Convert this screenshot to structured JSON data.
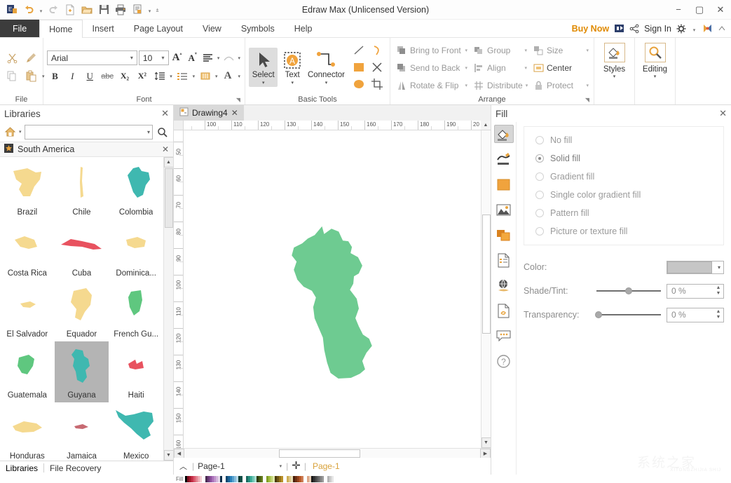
{
  "window": {
    "title": "Edraw Max (Unlicensed Version)",
    "minimize": "−",
    "maximize": "▢",
    "close": "✕"
  },
  "quick_access": {
    "logo": "edraw-logo-icon",
    "undo": "undo-icon",
    "undo_caret": "▾",
    "redo": "redo-icon",
    "new": "new-document-icon",
    "open": "open-folder-icon",
    "save": "save-icon",
    "print": "print-icon",
    "more": "quick-access-more-icon",
    "more_caret": "▾",
    "customize_caret": "▾"
  },
  "menu": {
    "file": "File",
    "tabs": [
      {
        "label": "Home",
        "active": true
      },
      {
        "label": "Insert",
        "active": false
      },
      {
        "label": "Page Layout",
        "active": false
      },
      {
        "label": "View",
        "active": false
      },
      {
        "label": "Symbols",
        "active": false
      },
      {
        "label": "Help",
        "active": false
      }
    ],
    "buy_now": "Buy Now",
    "sign_in": "Sign In",
    "cloud_icon": "cloud-save-icon",
    "share_icon": "share-icon",
    "settings_icon": "gear-icon",
    "settings_caret": "▾",
    "account_icon": "account-icon",
    "collapse_icon": "collapse-ribbon-icon"
  },
  "ribbon": {
    "file_group": {
      "title": "File",
      "cut": "cut-icon",
      "format_painter": "format-painter-icon",
      "copy": "copy-icon",
      "paste": "paste-icon",
      "paste_caret": "▾"
    },
    "font_group": {
      "title": "Font",
      "font_family": "Arial",
      "font_size": "10",
      "family_caret": "▾",
      "size_caret": "▾",
      "grow_font": "A",
      "shrink_font": "A",
      "align_icon": "text-align-icon",
      "align_caret": "▾",
      "curve_icon": "text-curve-icon",
      "curve_caret": "▾",
      "bold": "B",
      "italic": "I",
      "underline": "U",
      "strikethrough": "abc",
      "subscript": "X₂",
      "superscript": "X²",
      "line_spacing": "line-spacing-icon",
      "line_spacing_caret": "▾",
      "bullets": "bullet-list-icon",
      "bullets_caret": "▾",
      "highlight": "text-highlight-icon",
      "highlight_caret": "▾",
      "font_color": "A",
      "font_color_caret": "▾",
      "launcher": "◥"
    },
    "basic_tools": {
      "title": "Basic Tools",
      "select": {
        "label": "Select",
        "icon": "cursor-arrow-icon",
        "caret": "▾"
      },
      "text": {
        "label": "Text",
        "icon": "text-box-icon",
        "caret": "▾"
      },
      "connector": {
        "label": "Connector",
        "icon": "connector-icon",
        "caret": "▾"
      },
      "shapes": [
        {
          "name": "line-tool-icon"
        },
        {
          "name": "arc-tool-icon"
        },
        {
          "name": "rectangle-tool-icon"
        },
        {
          "name": "pen-tool-icon"
        },
        {
          "name": "ellipse-tool-icon"
        },
        {
          "name": "crop-tool-icon"
        }
      ]
    },
    "arrange": {
      "title": "Arrange",
      "items": [
        {
          "label": "Bring to Front",
          "icon": "bring-to-front-icon",
          "caret": "▾"
        },
        {
          "label": "Group",
          "icon": "group-icon",
          "caret": "▾"
        },
        {
          "label": "Size",
          "icon": "size-icon",
          "caret": "▾"
        },
        {
          "label": "Send to Back",
          "icon": "send-to-back-icon",
          "caret": "▾"
        },
        {
          "label": "Align",
          "icon": "align-icon",
          "caret": "▾"
        },
        {
          "label": "Center",
          "icon": "center-icon",
          "caret": ""
        },
        {
          "label": "Rotate & Flip",
          "icon": "rotate-flip-icon",
          "caret": "▾"
        },
        {
          "label": "Distribute",
          "icon": "distribute-icon",
          "caret": "▾"
        },
        {
          "label": "Protect",
          "icon": "protect-lock-icon",
          "caret": "▾"
        }
      ],
      "launcher": "◥"
    },
    "styles": {
      "label": "Styles",
      "icon": "styles-paint-icon",
      "caret": "▾"
    },
    "editing": {
      "label": "Editing",
      "icon": "magnifier-icon",
      "caret": "▾"
    }
  },
  "libraries": {
    "title": "Libraries",
    "close": "✕",
    "home_icon": "home-icon",
    "home_caret": "▾",
    "search_placeholder": "",
    "search_value": "",
    "search_caret": "▾",
    "search_icon": "search-icon",
    "category": {
      "icon": "library-category-icon",
      "name": "South America",
      "close": "✕"
    },
    "shapes": [
      {
        "name": "Brazil",
        "color": "#f5d98f",
        "selected": false
      },
      {
        "name": "Chile",
        "color": "#f5d98f",
        "selected": false
      },
      {
        "name": "Colombia",
        "color": "#3fb8b0",
        "selected": false
      },
      {
        "name": "Costa Rica",
        "color": "#f5d98f",
        "selected": false
      },
      {
        "name": "Cuba",
        "color": "#e8525f",
        "selected": false
      },
      {
        "name": "Dominica...",
        "color": "#f5d98f",
        "selected": false
      },
      {
        "name": "El Salvador",
        "color": "#f5d98f",
        "selected": false
      },
      {
        "name": "Equador",
        "color": "#f5d98f",
        "selected": false
      },
      {
        "name": "French Gu...",
        "color": "#5fc77f",
        "selected": false
      },
      {
        "name": "Guatemala",
        "color": "#5fc77f",
        "selected": false
      },
      {
        "name": "Guyana",
        "color": "#3fb8b0",
        "selected": true
      },
      {
        "name": "Haiti",
        "color": "#e8525f",
        "selected": false
      },
      {
        "name": "Honduras",
        "color": "#f5d98f",
        "selected": false
      },
      {
        "name": "Jamaica",
        "color": "#c76a72",
        "selected": false
      },
      {
        "name": "Mexico",
        "color": "#3fb8b0",
        "selected": false
      }
    ],
    "scroll_up": "▲",
    "scroll_down": "▼",
    "bottom_tabs": [
      {
        "label": "Libraries",
        "active": true
      },
      {
        "label": "File Recovery",
        "active": false
      }
    ]
  },
  "canvas": {
    "document_tab": {
      "icon": "document-icon",
      "name": "Drawing4",
      "close": "✕"
    },
    "h_ruler_labels": [
      "100",
      "110",
      "120",
      "130",
      "140",
      "150",
      "160",
      "170",
      "180",
      "190",
      "20"
    ],
    "v_ruler_labels": [
      "50",
      "60",
      "70",
      "80",
      "90",
      "100",
      "110",
      "120",
      "130",
      "140",
      "150",
      "160"
    ],
    "shape": {
      "name": "guyana-map-shape",
      "fill": "#6ecb91"
    },
    "scroll_left": "◀",
    "scroll_right": "▶",
    "scroll_up": "▲",
    "scroll_down": "▼"
  },
  "status": {
    "collapse": "︿",
    "page_name": "Page-1",
    "page_caret": "▾",
    "add_page": "✛",
    "page_tab": "Page-1",
    "fill_label": "Fill"
  },
  "fill_panel": {
    "title": "Fill",
    "close": "✕",
    "side_icons": [
      {
        "name": "fill-bucket-icon",
        "selected": true
      },
      {
        "name": "line-style-icon",
        "selected": false
      },
      {
        "name": "shape-color-icon",
        "selected": false
      },
      {
        "name": "picture-icon",
        "selected": false
      },
      {
        "name": "shadow-icon",
        "selected": false
      },
      {
        "name": "page-setup-icon",
        "selected": false
      },
      {
        "name": "theme-globe-icon",
        "selected": false
      },
      {
        "name": "hyperlink-icon",
        "selected": false
      },
      {
        "name": "comment-icon",
        "selected": false
      },
      {
        "name": "help-icon",
        "selected": false
      }
    ],
    "options": [
      {
        "label": "No fill",
        "selected": false
      },
      {
        "label": "Solid fill",
        "selected": true
      },
      {
        "label": "Gradient fill",
        "selected": false
      },
      {
        "label": "Single color gradient fill",
        "selected": false
      },
      {
        "label": "Pattern fill",
        "selected": false
      },
      {
        "label": "Picture or texture fill",
        "selected": false
      }
    ],
    "color_label": "Color:",
    "color_value": "#c6c6c6",
    "color_caret": "▾",
    "shade_label": "Shade/Tint:",
    "shade_value": "0 %",
    "shade_percent": 50,
    "transparency_label": "Transparency:",
    "transparency_value": "0 %",
    "transparency_percent": 0,
    "spin_up": "▲",
    "spin_down": "▼"
  },
  "watermark": {
    "text": "系统之家",
    "sub": "XITONGZHIJIA SHIJ"
  },
  "palette": {
    "colors": [
      "#000000",
      "#7f1021",
      "#a81b2e",
      "#c7304a",
      "#d9596d",
      "#e3828f",
      "#edaab3",
      "#f4cdd3",
      "#4a2a52",
      "#6b3b78",
      "#8c4f9b",
      "#a96fb8",
      "#bf92cb",
      "#d3b5db",
      "#e6d8ea",
      "#0b2d4a",
      "#13486f",
      "#1a6396",
      "#2a81ba",
      "#55a0cd",
      "#86bddc",
      "#b7daea",
      "#0d3a33",
      "#145048",
      "#1b6a5f",
      "#258f7e",
      "#3fae99",
      "#74c7b6",
      "#a9dfd3",
      "#2d3a0b",
      "#465a13",
      "#61791b",
      "#819f25",
      "#a2be3f",
      "#c1d474",
      "#dfe9a9",
      "#4a3a0b",
      "#6f5613",
      "#96731a",
      "#ba9129",
      "#cdae55",
      "#dcc786",
      "#eaddb7",
      "#4a1f0b",
      "#6f3113",
      "#96431a",
      "#ba5a29",
      "#cd7d55",
      "#dca686",
      "#eacfb7",
      "#1a1a1a",
      "#333333",
      "#4d4d4d",
      "#666666",
      "#808080",
      "#999999",
      "#b3b3b3",
      "#cccccc",
      "#e6e6e6"
    ]
  }
}
